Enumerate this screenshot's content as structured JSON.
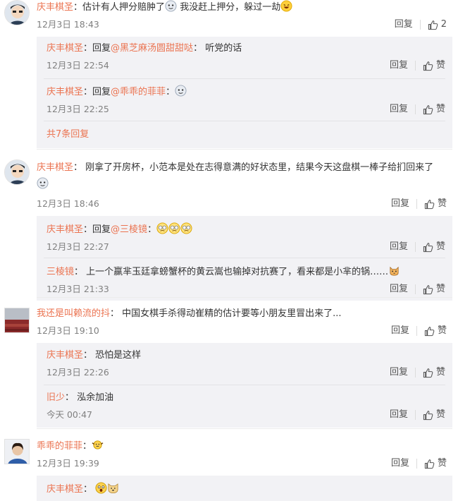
{
  "labels": {
    "reply": "回复",
    "like": "赞"
  },
  "colors": {
    "name": "#eb7350",
    "meta": "#808080",
    "sub_bg": "#f2f2f5"
  },
  "comments": [
    {
      "user": "庆丰棋圣",
      "avatar": "avatar-cartoon-face",
      "text_a": "估计有人押分赔肿了",
      "text_b": "我没赶上押分，躲过一劫",
      "time": "12月3日 18:43",
      "like_count": "2",
      "replies": [
        {
          "user": "庆丰棋圣",
          "prefix": "回复",
          "at": "@黑芝麻汤圆甜甜哒",
          "text": "听党的话",
          "time": "12月3日 22:54"
        },
        {
          "user": "庆丰棋圣",
          "prefix": "回复",
          "at": "@乖乖的菲菲",
          "text": "",
          "time": "12月3日 22:25"
        }
      ],
      "more": "共7条回复"
    },
    {
      "user": "庆丰棋圣",
      "avatar": "avatar-cartoon-face",
      "text": "刚拿了开房杯，小范本是处在志得意满的好状态里，结果今天这盘棋一棒子给扪回来了",
      "time": "12月3日 18:46",
      "replies": [
        {
          "user": "庆丰棋圣",
          "prefix": "回复",
          "at": "@三棱镜",
          "text": "",
          "time": "12月3日 22:27"
        },
        {
          "user": "三棱镜",
          "text": "上一个赢芈玉廷拿螃蟹杯的黄云嵩也输掉对抗赛了，看来都是小芈的锅……",
          "time": "12月3日 21:33"
        }
      ]
    },
    {
      "user": "我还是叫赖流的抖",
      "avatar": "avatar-red-landscape",
      "text": "中国女棋手杀得动崔精的估计要等小朋友里冒出来了...",
      "time": "12月3日 19:10",
      "replies": [
        {
          "user": "庆丰棋圣",
          "text": "恐怕是这样",
          "time": "12月3日 22:26"
        },
        {
          "user": "旧少",
          "text": "泓余加油",
          "time": "今天 00:47"
        }
      ]
    },
    {
      "user": "乖乖的菲菲",
      "avatar": "avatar-woman-portrait",
      "text": "",
      "time": "12月3日 19:39",
      "replies": [
        {
          "user": "庆丰棋圣",
          "text": ""
        }
      ]
    }
  ]
}
